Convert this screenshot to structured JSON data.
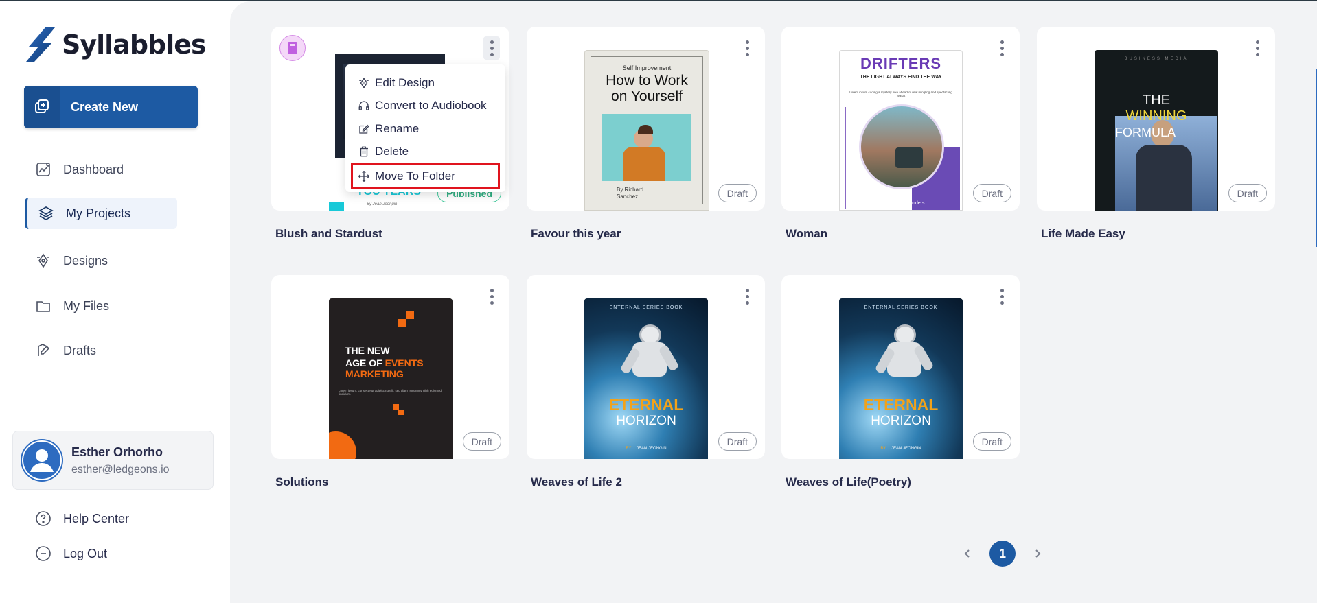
{
  "app": {
    "name": "Syllabbles"
  },
  "sidebar": {
    "create_label": "Create New",
    "items": [
      {
        "label": "Dashboard",
        "icon": "chart-icon"
      },
      {
        "label": "My Projects",
        "icon": "layers-icon",
        "active": true
      },
      {
        "label": "Designs",
        "icon": "pen-tool-icon"
      },
      {
        "label": "My Files",
        "icon": "folder-icon"
      },
      {
        "label": "Drafts",
        "icon": "drafts-icon"
      }
    ],
    "user": {
      "name": "Esther Orhorho",
      "email": "esther@ledgeons.io"
    },
    "help_label": "Help Center",
    "logout_label": "Log Out"
  },
  "projects": [
    {
      "title": "Blush and Stardust",
      "status": "Published"
    },
    {
      "title": "Favour this year",
      "status": "Draft"
    },
    {
      "title": "Woman",
      "status": "Draft"
    },
    {
      "title": "Life Made Easy",
      "status": "Draft"
    },
    {
      "title": "Solutions",
      "status": "Draft"
    },
    {
      "title": "Weaves of Life 2",
      "status": "Draft"
    },
    {
      "title": "Weaves of Life(Poetry)",
      "status": "Draft"
    }
  ],
  "covers": {
    "blush": {
      "bottom_text": "YOU YEARS",
      "author": "By Jean Jeongin"
    },
    "favour": {
      "kicker": "Self Improvement",
      "title_line1": "How to Work",
      "title_line2": "on Yourself",
      "author_line1": "By Richard",
      "author_line2": "Sanchez"
    },
    "woman": {
      "title": "DRIFTERS",
      "subtitle": "THE LIGHT ALWAYS FIND THE WAY",
      "blurb": "Lorem ipsum coding a mystery hike ahead of dew mingling and spectacling Wasat",
      "author": "r By Denis Landers..."
    },
    "lifemade": {
      "kicker": "BUSINESS MEDIA",
      "line1": "THE",
      "line2": "WINNING",
      "line3": "FORMULA"
    },
    "solutions": {
      "line1": "THE NEW",
      "line2a": "AGE OF",
      "line2b": "EVENTS",
      "line3": "MARKETING",
      "blurb": "Lorem ipsum, consectetur adipiscing elit, sed diam nonummy nibh euismod tincidunt."
    },
    "eternal": {
      "kicker": "ENTERNAL   SERIES   BOOK",
      "line1": "ETERNAL",
      "line2": "HORIZON",
      "by": "BY",
      "author": "JEAN JEONGIN"
    }
  },
  "context_menu": {
    "items": [
      {
        "label": "Edit Design",
        "icon": "pen-tool-icon"
      },
      {
        "label": "Convert to Audiobook",
        "icon": "headphones-icon"
      },
      {
        "label": "Rename",
        "icon": "edit-icon"
      },
      {
        "label": "Delete",
        "icon": "trash-icon"
      },
      {
        "label": "Move To Folder",
        "icon": "move-icon",
        "highlighted": true
      }
    ]
  },
  "pagination": {
    "current": "1"
  },
  "colors": {
    "brand": "#1d5aa3",
    "published": "#2faf82",
    "highlight_box": "#e0141e"
  }
}
